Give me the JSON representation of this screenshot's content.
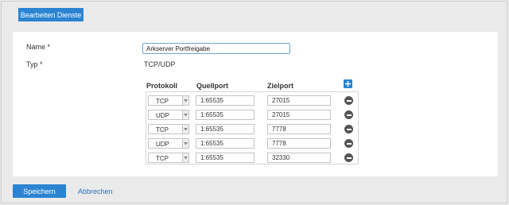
{
  "header": {
    "title_button": "Bearbeiten Dienste"
  },
  "form": {
    "name_label": "Name *",
    "name_value": "Arkserver Portfreigabe",
    "type_label": "Typ *",
    "type_value": "TCP/UDP",
    "columns": {
      "protocol": "Protokoll",
      "source_port": "Quellport",
      "dest_port": "Zielport"
    },
    "rows": [
      {
        "protocol": "TCP",
        "source_port": "1:65535",
        "dest_port": "27015"
      },
      {
        "protocol": "UDP",
        "source_port": "1:65535",
        "dest_port": "27015"
      },
      {
        "protocol": "TCP",
        "source_port": "1:65535",
        "dest_port": "7778"
      },
      {
        "protocol": "UDP",
        "source_port": "1:65535",
        "dest_port": "7778"
      },
      {
        "protocol": "TCP",
        "source_port": "1:65535",
        "dest_port": "32330"
      }
    ]
  },
  "footer": {
    "save_label": "Speichern",
    "cancel_label": "Abbrechen"
  },
  "icons": {
    "add": "plus-icon",
    "remove": "minus-circle-icon",
    "dropdown": "chevron-down-icon"
  },
  "colors": {
    "accent": "#2a84d2",
    "remove": "#555555",
    "link": "#2a6fb8"
  }
}
